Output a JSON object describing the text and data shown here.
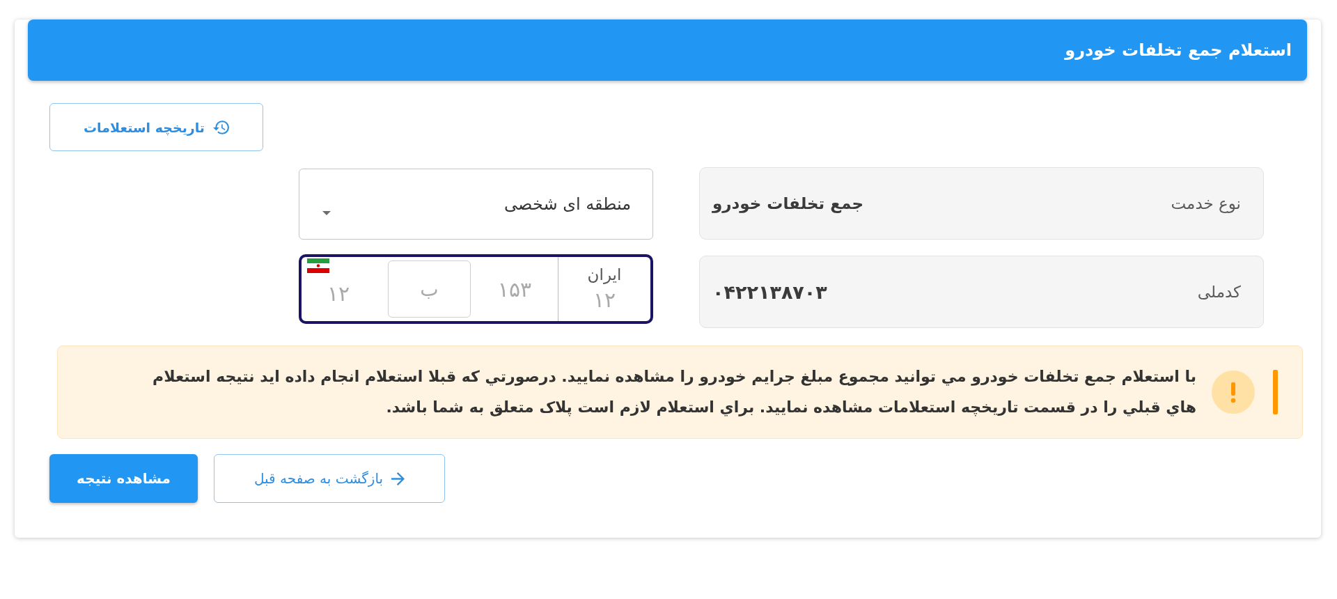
{
  "header": {
    "title": "استعلام جمع تخلفات خودرو"
  },
  "history_button": {
    "label": "تاریخچه استعلامات"
  },
  "form": {
    "fields": [
      {
        "label": "نوع خدمت",
        "value": "جمع تخلفات خودرو"
      },
      {
        "label": "کدملی",
        "value": "۰۴۲۲۱۳۸۷۰۳"
      }
    ],
    "plate_type_select": {
      "value": "منطقه ای شخصی"
    },
    "plate": {
      "part_1_placeholder": "۱۲",
      "letter_placeholder": "ب",
      "part_2_placeholder": "۱۵۳",
      "region_label": "ایران",
      "region_placeholder": "۱۲"
    }
  },
  "alert": {
    "kind": "warning",
    "text": "با استعلام جمع تخلفات خودرو مي توانيد مجموع مبلغ جرايم خودرو را مشاهده نماييد. درصورتي که قبلا استعلام انجام داده ايد نتيجه استعلام هاي قبلي را در قسمت تاريخچه استعلامات مشاهده نماييد. براي استعلام لازم است پلاک متعلق به شما باشد."
  },
  "buttons": [
    {
      "kind": "back",
      "label": "بازگشت به صفحه قبل"
    },
    {
      "kind": "submit",
      "label": "مشاهده نتیجه"
    }
  ]
}
